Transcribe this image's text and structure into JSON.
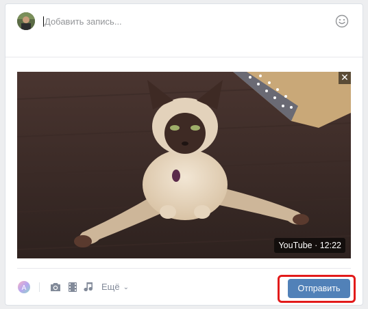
{
  "composer": {
    "placeholder": "Добавить запись...",
    "emoji_icon": "smile-icon",
    "avatar_icon": "user-avatar"
  },
  "attachment": {
    "type": "video",
    "source_label": "YouTube · 12:22",
    "close_label": "✕"
  },
  "toolbar": {
    "icons": [
      "poster-icon",
      "camera-icon",
      "film-icon",
      "music-note-icon"
    ],
    "more_label": "Ещё",
    "send_label": "Отправить"
  },
  "colors": {
    "accent": "#5181b8",
    "highlight": "#e21a1a",
    "icon": "#828a99"
  }
}
